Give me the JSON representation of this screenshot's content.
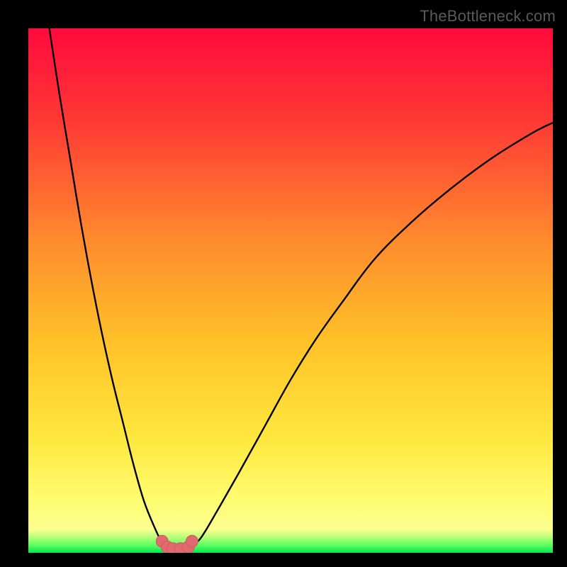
{
  "watermark": "TheBottleneck.com",
  "chart_data": {
    "type": "line",
    "title": "",
    "xlabel": "",
    "ylabel": "",
    "xlim": [
      0,
      100
    ],
    "ylim": [
      0,
      100
    ],
    "curve_left": {
      "x": [
        4,
        6,
        8,
        10,
        12,
        14,
        16,
        18,
        20,
        22,
        24,
        25.5,
        27
      ],
      "y": [
        100,
        87,
        75,
        63,
        52,
        42,
        33,
        25,
        17,
        10,
        5,
        2,
        1
      ]
    },
    "curve_right": {
      "x": [
        31,
        33,
        36,
        40,
        45,
        50,
        55,
        60,
        66,
        73,
        80,
        88,
        96,
        100
      ],
      "y": [
        1,
        3,
        8,
        15,
        24,
        33,
        41,
        48,
        56,
        63,
        69,
        75,
        80,
        82
      ]
    },
    "valley_markers": {
      "x": [
        25.5,
        26.5,
        27.5,
        29,
        30.5,
        31.2
      ],
      "y": [
        2.2,
        1.1,
        0.8,
        0.8,
        1.1,
        2.2
      ]
    },
    "green_band": {
      "y_start": 0,
      "y_end": 4
    },
    "gradient_stops": [
      {
        "pos": 0.0,
        "color": "#ff0a3c"
      },
      {
        "pos": 0.18,
        "color": "#ff3a34"
      },
      {
        "pos": 0.4,
        "color": "#ff8a2e"
      },
      {
        "pos": 0.6,
        "color": "#ffc228"
      },
      {
        "pos": 0.78,
        "color": "#ffe73e"
      },
      {
        "pos": 0.9,
        "color": "#fffc70"
      },
      {
        "pos": 0.955,
        "color": "#fcff90"
      },
      {
        "pos": 0.97,
        "color": "#b8ff7a"
      },
      {
        "pos": 0.985,
        "color": "#5eff62"
      },
      {
        "pos": 1.0,
        "color": "#00e64d"
      }
    ],
    "marker_color": "#e06a70",
    "marker_stroke": "#d15a60"
  }
}
